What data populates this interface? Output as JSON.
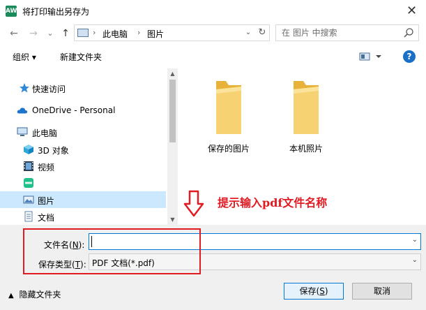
{
  "window": {
    "app_icon_text": "AW",
    "title": "将打印输出另存为",
    "close_glyph": "✕"
  },
  "nav": {
    "back_glyph": "←",
    "forward_glyph": "→",
    "recent_glyph": "⌄",
    "up_glyph": "↑"
  },
  "address": {
    "crumbs": [
      "此电脑",
      "图片"
    ],
    "separator": "›",
    "dropdown_glyph": "⌄",
    "refresh_glyph": "↻"
  },
  "search": {
    "placeholder": "在 图片 中搜索"
  },
  "toolbar": {
    "organize_label": "组织 ▾",
    "new_folder_label": "新建文件夹",
    "help_glyph": "?"
  },
  "sidebar": {
    "items": [
      {
        "label": "快速访问",
        "icon": "star-icon"
      },
      {
        "label": "OneDrive - Personal",
        "icon": "cloud-icon"
      },
      {
        "label": "此电脑",
        "icon": "computer-icon"
      },
      {
        "label": "3D 对象",
        "icon": "cube-icon"
      },
      {
        "label": "视频",
        "icon": "film-icon"
      },
      {
        "label": "",
        "icon": "app-icon"
      },
      {
        "label": "图片",
        "icon": "pictures-icon",
        "selected": true
      },
      {
        "label": "文档",
        "icon": "document-icon"
      }
    ]
  },
  "content": {
    "folders": [
      {
        "label": "保存的图片"
      },
      {
        "label": "本机照片"
      }
    ]
  },
  "annotation": {
    "text": "提示输入pdf文件名称",
    "color": "#e21b23"
  },
  "form": {
    "filename_label": "文件名(",
    "filename_accel": "N",
    "filename_label_end": "):",
    "filename_value": "",
    "filetype_label": "保存类型(",
    "filetype_accel": "T",
    "filetype_label_end": "):",
    "filetype_value": "PDF 文档(*.pdf)"
  },
  "footer": {
    "hide_folders_label": "隐藏文件夹",
    "save_label": "保存(",
    "save_accel": "S",
    "save_label_end": ")",
    "cancel_label": "取消"
  },
  "colors": {
    "accent": "#0078d7",
    "selection": "#cce8ff",
    "folder": "#f6c444"
  }
}
